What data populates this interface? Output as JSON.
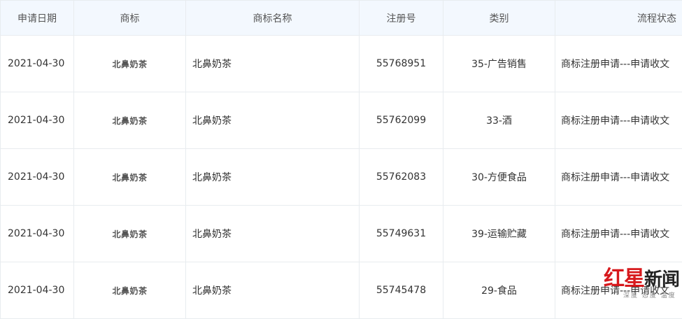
{
  "table": {
    "headers": [
      "申请日期",
      "商标",
      "商标名称",
      "注册号",
      "类别",
      "流程状态"
    ],
    "rows": [
      {
        "date": "2021-04-30",
        "mark": "北鼻奶茶",
        "name": "北鼻奶茶",
        "reg_no": "55768951",
        "category": "35-广告销售",
        "status": "商标注册申请---申请收文"
      },
      {
        "date": "2021-04-30",
        "mark": "北鼻奶茶",
        "name": "北鼻奶茶",
        "reg_no": "55762099",
        "category": "33-酒",
        "status": "商标注册申请---申请收文"
      },
      {
        "date": "2021-04-30",
        "mark": "北鼻奶茶",
        "name": "北鼻奶茶",
        "reg_no": "55762083",
        "category": "30-方便食品",
        "status": "商标注册申请---申请收文"
      },
      {
        "date": "2021-04-30",
        "mark": "北鼻奶茶",
        "name": "北鼻奶茶",
        "reg_no": "55749631",
        "category": "39-运输贮藏",
        "status": "商标注册申请---申请收文"
      },
      {
        "date": "2021-04-30",
        "mark": "北鼻奶茶",
        "name": "北鼻奶茶",
        "reg_no": "55745478",
        "category": "29-食品",
        "status": "商标注册申请---申请收文"
      }
    ]
  },
  "watermark": {
    "logo_red": "红星",
    "logo_dark": "新闻",
    "slogan": "深度 态度 温度"
  }
}
